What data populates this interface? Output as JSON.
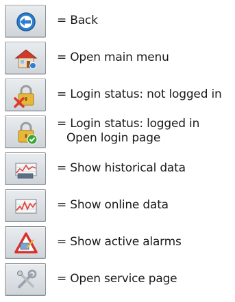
{
  "legend": {
    "items": [
      {
        "icon": "back-arrow-icon",
        "lines": [
          "= Back"
        ]
      },
      {
        "icon": "home-house-icon",
        "lines": [
          "= Open main menu"
        ]
      },
      {
        "icon": "lock-not-logged-in-icon",
        "lines": [
          "= Login status: not logged in"
        ]
      },
      {
        "icon": "lock-logged-in-icon",
        "lines": [
          "= Login status: logged in",
          "Open login page"
        ]
      },
      {
        "icon": "historical-data-chart-icon",
        "lines": [
          "= Show historical data"
        ]
      },
      {
        "icon": "online-data-trend-icon",
        "lines": [
          "= Show online data"
        ]
      },
      {
        "icon": "alarm-warning-icon",
        "lines": [
          "= Show active alarms"
        ]
      },
      {
        "icon": "service-tools-icon",
        "lines": [
          "= Open service page"
        ]
      }
    ]
  },
  "colors": {
    "button_face": "#dde1e5",
    "button_border": "#8c9196",
    "back_blue": "#2e7fd0",
    "house_red": "#d23a2a",
    "lock_gold": "#e8b73a",
    "status_red": "#d93a2f",
    "status_green": "#3aa53a",
    "alarm_red": "#d8322a",
    "chart_red": "#e0453a"
  }
}
